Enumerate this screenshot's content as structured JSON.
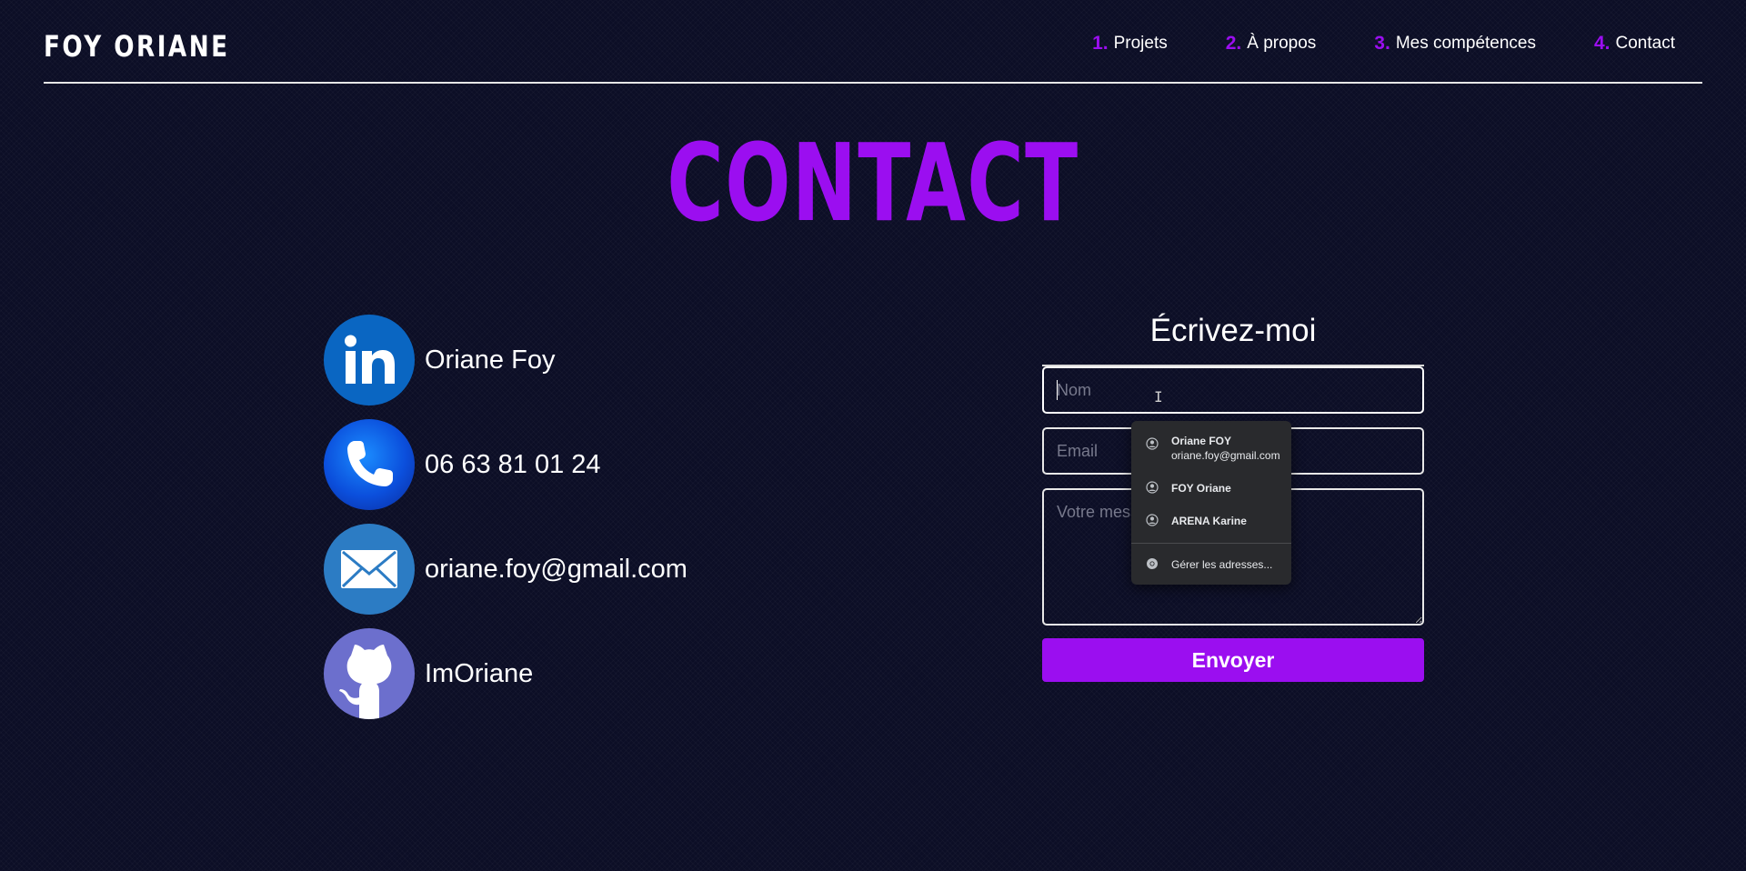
{
  "header": {
    "brand": "FOY ORIANE",
    "nav": [
      {
        "num": "1.",
        "label": "Projets"
      },
      {
        "num": "2.",
        "label": "À propos"
      },
      {
        "num": "3.",
        "label": "Mes compétences"
      },
      {
        "num": "4.",
        "label": "Contact"
      }
    ]
  },
  "page": {
    "title": "CONTACT"
  },
  "contacts": [
    {
      "icon": "linkedin-icon",
      "label": "Oriane Foy"
    },
    {
      "icon": "phone-icon",
      "label": "06 63 81 01 24"
    },
    {
      "icon": "mail-icon",
      "label": "oriane.foy@gmail.com"
    },
    {
      "icon": "github-icon",
      "label": "ImOriane"
    }
  ],
  "form": {
    "title": "Écrivez-moi",
    "name_placeholder": "Nom",
    "name_value": "",
    "email_placeholder": "Email",
    "email_value": "",
    "message_placeholder": "Votre message",
    "message_value": "",
    "submit_label": "Envoyer"
  },
  "autofill": {
    "items": [
      {
        "name": "Oriane FOY",
        "detail": "oriane.foy@gmail.com"
      },
      {
        "name": "FOY Oriane",
        "detail": ""
      },
      {
        "name": "ARENA Karine",
        "detail": ""
      }
    ],
    "manage_label": "Gérer les adresses..."
  },
  "colors": {
    "accent": "#9b0ef0",
    "background": "#0c0e26",
    "text": "#ffffff"
  }
}
